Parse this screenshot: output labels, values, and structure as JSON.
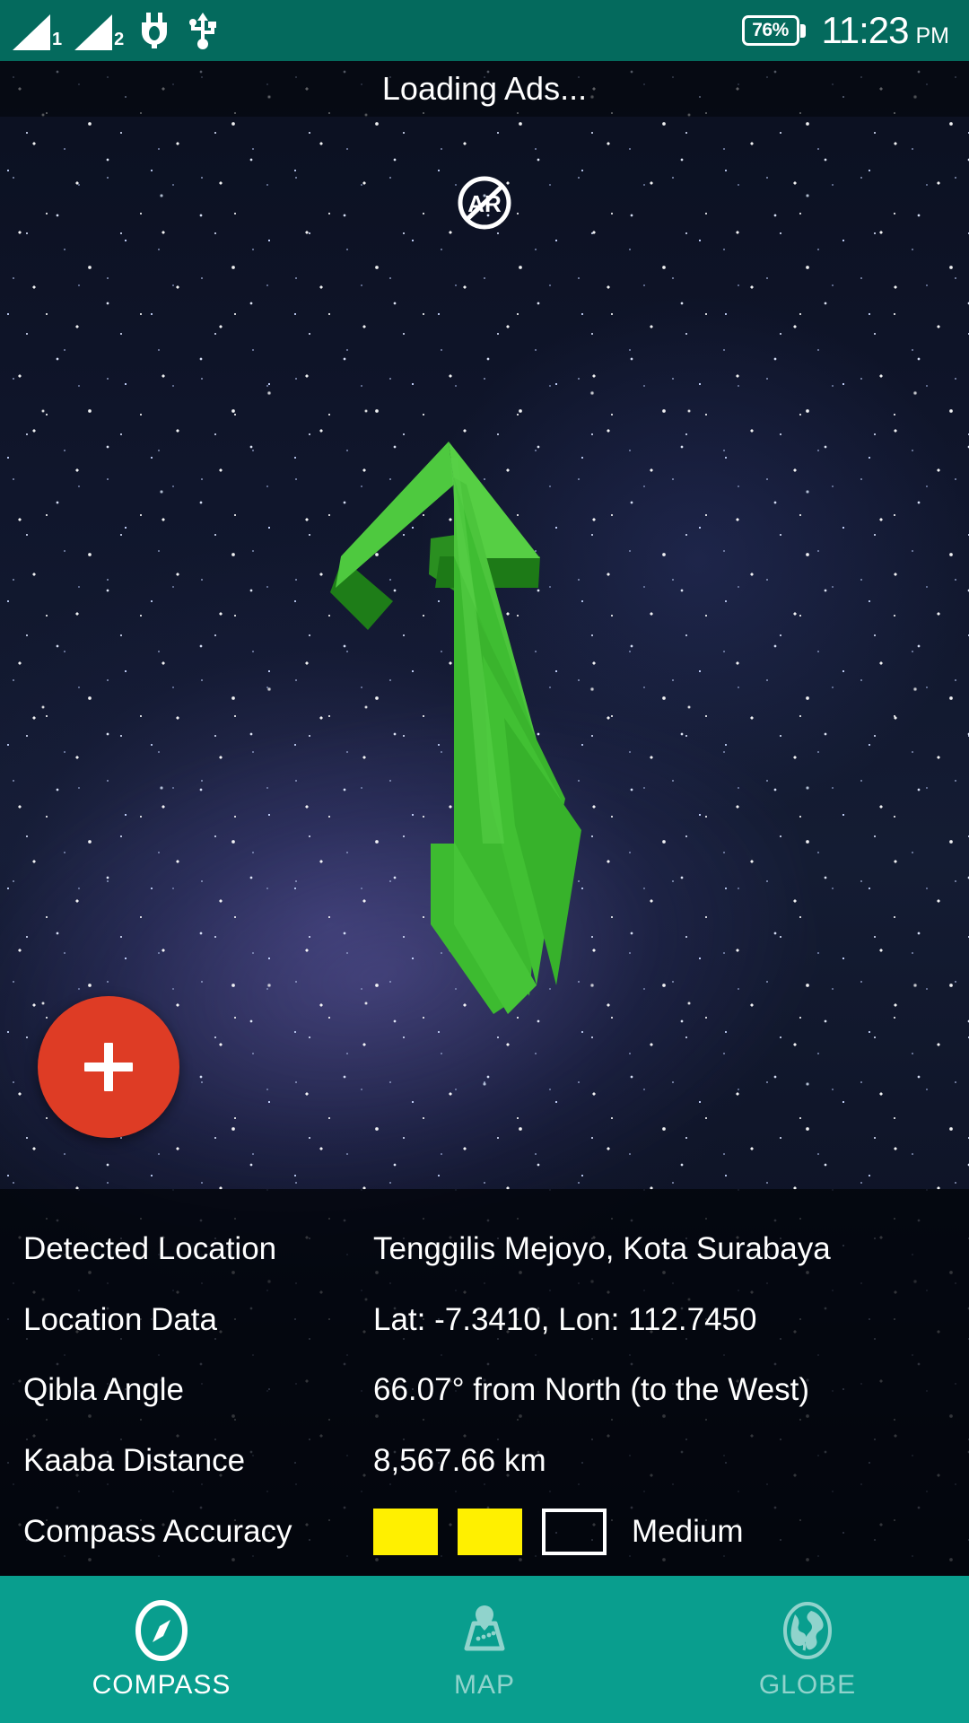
{
  "statusbar": {
    "sim1_label": "1",
    "sim2_label": "2",
    "battery_percent": "76%",
    "time": "11:23",
    "ampm": "PM",
    "icons": [
      "signal-bars-sim1-icon",
      "signal-bars-sim2-icon",
      "charging-plug-icon",
      "usb-icon",
      "battery-icon"
    ]
  },
  "titlebar": {
    "title": "Loading Ads..."
  },
  "ar_button": {
    "label": "AR",
    "state": "disabled"
  },
  "fab": {
    "label": "+",
    "color": "#de3c25"
  },
  "info": {
    "rows": [
      {
        "label": "Detected Location",
        "value": "Tenggilis Mejoyo, Kota Surabaya"
      },
      {
        "label": "Location Data",
        "value": "Lat: -7.3410, Lon: 112.7450"
      },
      {
        "label": "Qibla Angle",
        "value": "66.07° from North (to the West)"
      },
      {
        "label": "Kaaba Distance",
        "value": "8,567.66 km"
      }
    ],
    "accuracy": {
      "label": "Compass Accuracy",
      "level_text": "Medium",
      "filled": 2,
      "total": 3,
      "fill_color": "#fff000"
    }
  },
  "navbar": {
    "background": "#099e8e",
    "items": [
      {
        "label": "COMPASS",
        "icon": "compass-icon",
        "active": true
      },
      {
        "label": "MAP",
        "icon": "map-icon",
        "active": false
      },
      {
        "label": "GLOBE",
        "icon": "globe-icon",
        "active": false
      }
    ]
  }
}
